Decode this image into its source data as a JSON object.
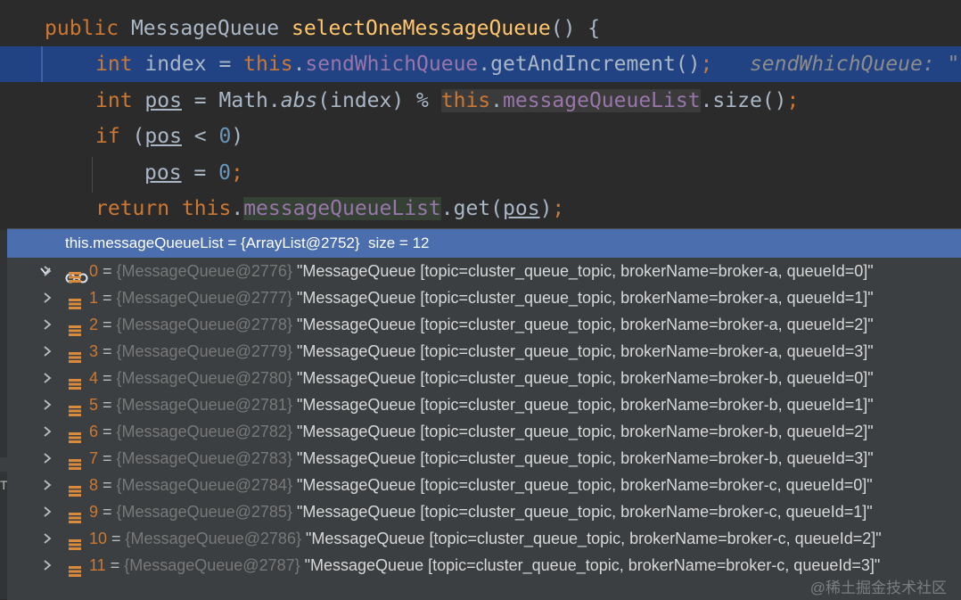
{
  "code": {
    "line1": {
      "kw": "public",
      "type": " MessageQueue ",
      "method": "selectOneMessageQueue",
      "rest": "() {"
    },
    "line2": {
      "kw": "int",
      "var": " index = ",
      "this": "this",
      "dot": ".",
      "field": "sendWhichQueue",
      "rest": ".getAndIncrement()",
      "semi": ";",
      "hint": "sendWhichQueue: \""
    },
    "line3": {
      "kw": "int",
      "sp": " ",
      "var": "pos",
      "eq": " = Math.",
      "call": "abs",
      "args": "(index) % ",
      "this": "this",
      "dot": ".",
      "field": "messageQueueList",
      "rest": ".size()",
      "semi": ";"
    },
    "line4": {
      "kw": "if",
      "open": " (",
      "var": "pos",
      "op": " < ",
      "num": "0",
      "close": ")"
    },
    "line5": {
      "var": "pos",
      "eq": " = ",
      "num": "0",
      "semi": ";"
    },
    "line6": {
      "kw": "return",
      "sp": " ",
      "this": "this",
      "dot": ".",
      "field": "messageQueueList",
      "get": ".get(",
      "var": "pos",
      "close": ")",
      "semi": ";"
    }
  },
  "debug_popup": {
    "header": "this.messageQueueList = {ArrayList@2752}  size = 12",
    "items": [
      {
        "index": "0",
        "eq": " = ",
        "ref": "{MessageQueue@2776}",
        "value": " \"MessageQueue [topic=cluster_queue_topic, brokerName=broker-a, queueId=0]\""
      },
      {
        "index": "1",
        "eq": " = ",
        "ref": "{MessageQueue@2777}",
        "value": " \"MessageQueue [topic=cluster_queue_topic, brokerName=broker-a, queueId=1]\""
      },
      {
        "index": "2",
        "eq": " = ",
        "ref": "{MessageQueue@2778}",
        "value": " \"MessageQueue [topic=cluster_queue_topic, brokerName=broker-a, queueId=2]\""
      },
      {
        "index": "3",
        "eq": " = ",
        "ref": "{MessageQueue@2779}",
        "value": " \"MessageQueue [topic=cluster_queue_topic, brokerName=broker-a, queueId=3]\""
      },
      {
        "index": "4",
        "eq": " = ",
        "ref": "{MessageQueue@2780}",
        "value": " \"MessageQueue [topic=cluster_queue_topic, brokerName=broker-b, queueId=0]\""
      },
      {
        "index": "5",
        "eq": " = ",
        "ref": "{MessageQueue@2781}",
        "value": " \"MessageQueue [topic=cluster_queue_topic, brokerName=broker-b, queueId=1]\""
      },
      {
        "index": "6",
        "eq": " = ",
        "ref": "{MessageQueue@2782}",
        "value": " \"MessageQueue [topic=cluster_queue_topic, brokerName=broker-b, queueId=2]\""
      },
      {
        "index": "7",
        "eq": " = ",
        "ref": "{MessageQueue@2783}",
        "value": " \"MessageQueue [topic=cluster_queue_topic, brokerName=broker-b, queueId=3]\""
      },
      {
        "index": "8",
        "eq": " = ",
        "ref": "{MessageQueue@2784}",
        "value": " \"MessageQueue [topic=cluster_queue_topic, brokerName=broker-c, queueId=0]\""
      },
      {
        "index": "9",
        "eq": " = ",
        "ref": "{MessageQueue@2785}",
        "value": " \"MessageQueue [topic=cluster_queue_topic, brokerName=broker-c, queueId=1]\""
      },
      {
        "index": "10",
        "eq": " = ",
        "ref": "{MessageQueue@2786}",
        "value": " \"MessageQueue [topic=cluster_queue_topic, brokerName=broker-c, queueId=2]\""
      },
      {
        "index": "11",
        "eq": " = ",
        "ref": "{MessageQueue@2787}",
        "value": " \"MessageQueue [topic=cluster_queue_topic, brokerName=broker-c, queueId=3]\""
      }
    ]
  },
  "gutter": {
    "letter": "T"
  },
  "watermark": "@稀土掘金技术社区",
  "colors": {
    "keyword": "#cc7832",
    "method": "#ffc66d",
    "field": "#9876aa",
    "number": "#6897bb",
    "selection": "#214283",
    "popup_header": "#4b6eaf"
  }
}
